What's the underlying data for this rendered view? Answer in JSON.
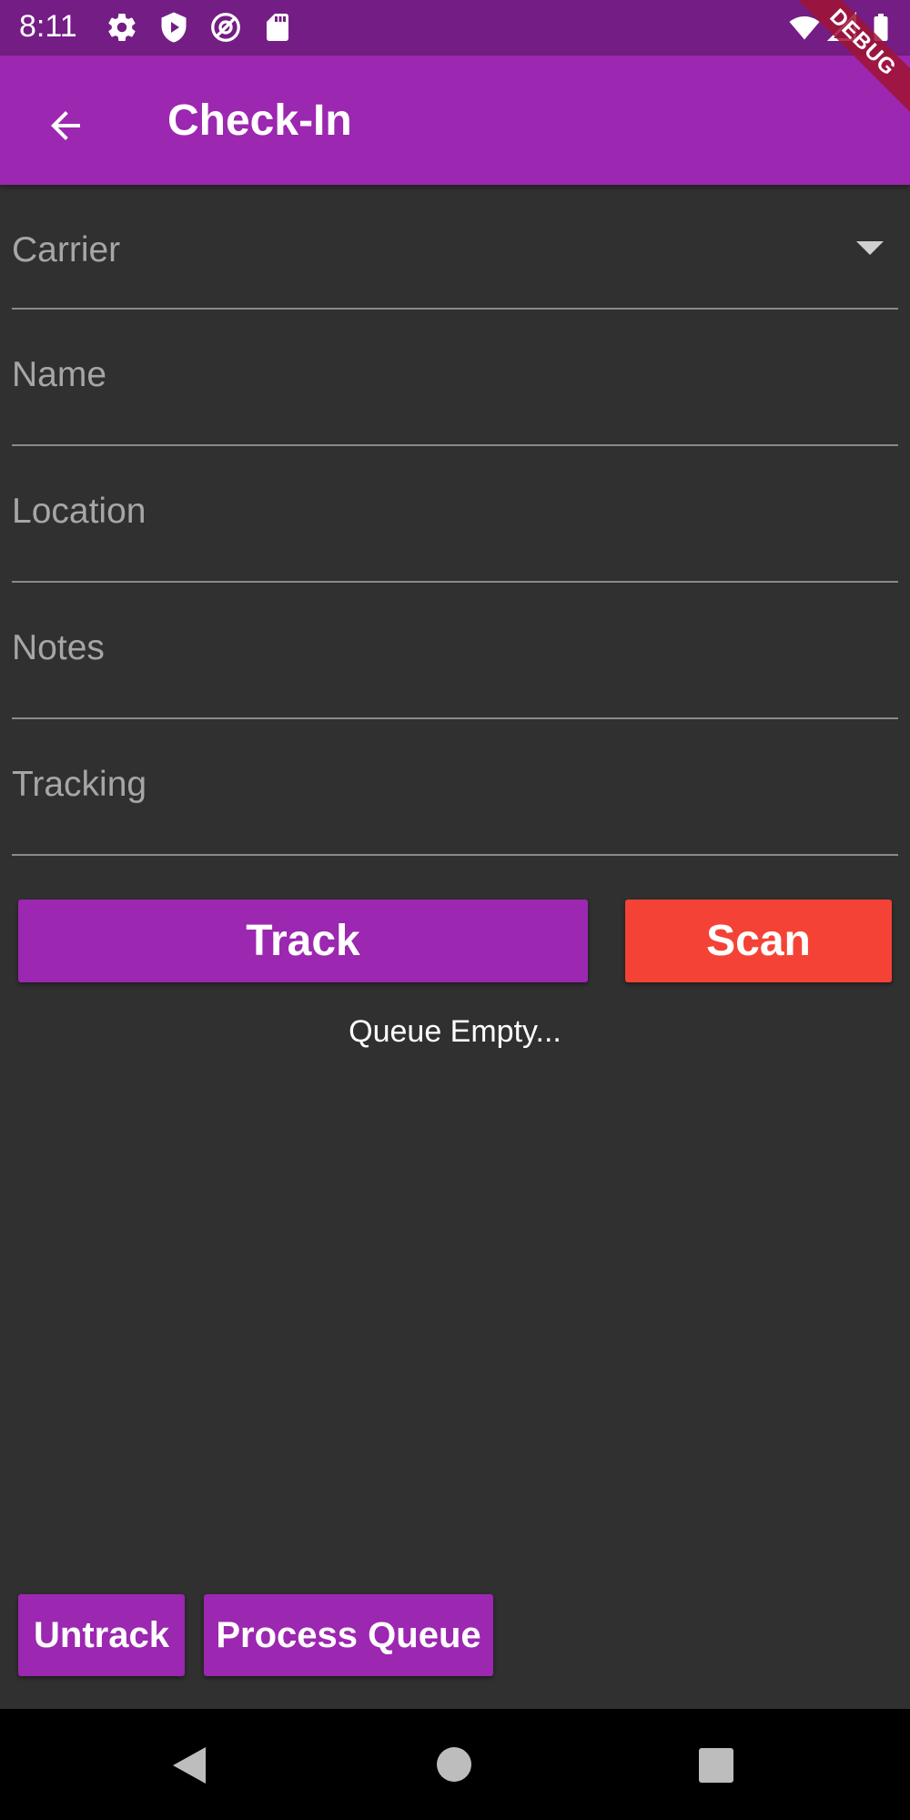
{
  "status_bar": {
    "time": "8:11",
    "left_icons": [
      "settings-icon",
      "shield-icon",
      "at-sign-icon",
      "sd-card-icon"
    ],
    "right_icons": [
      "wifi-icon",
      "signal-icon",
      "battery-icon"
    ]
  },
  "debug_banner": "DEBUG",
  "app_bar": {
    "title": "Check-In",
    "back_icon": "arrow-back-icon"
  },
  "form": {
    "carrier_label": "Carrier",
    "name_label": "Name",
    "location_label": "Location",
    "notes_label": "Notes",
    "tracking_label": "Tracking"
  },
  "actions": {
    "track_label": "Track",
    "scan_label": "Scan"
  },
  "queue_status": "Queue Empty...",
  "bottom_actions": {
    "untrack_label": "Untrack",
    "process_queue_label": "Process Queue"
  },
  "nav_bar": {
    "icons": [
      "back-icon",
      "home-icon",
      "recents-icon"
    ]
  },
  "colors": {
    "primary": "#9c27b0",
    "primary_dark": "#741d85",
    "scan_red": "#f44336",
    "background": "#303030"
  }
}
